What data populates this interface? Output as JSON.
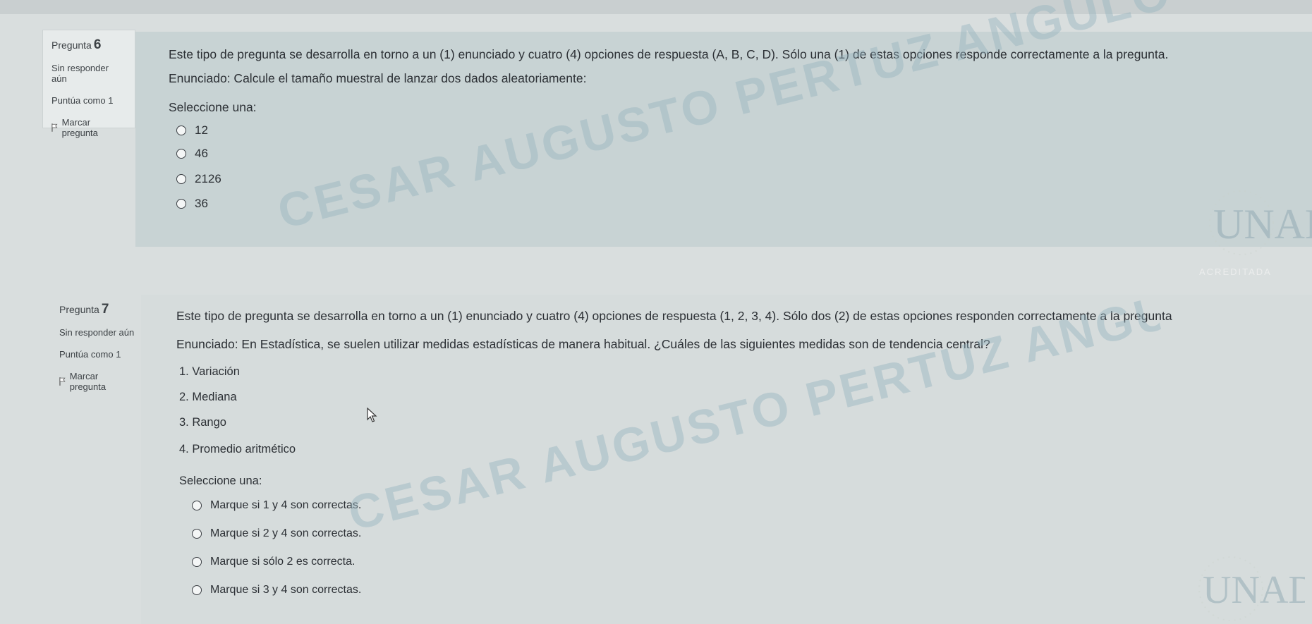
{
  "q6": {
    "label": "Pregunta",
    "number": "6",
    "status": "Sin responder aún",
    "score": "Puntúa como 1",
    "flag": "Marcar pregunta",
    "instructions": "Este tipo de pregunta se desarrolla en torno a un (1) enunciado y cuatro (4) opciones de respuesta (A, B, C, D). Sólo una (1) de estas opciones responde correctamente a la pregunta.",
    "statement": "Enunciado: Calcule el tamaño muestral de lanzar dos dados aleatoriamente:",
    "select_label": "Seleccione una:",
    "options": [
      "12",
      "46",
      "2126",
      "36"
    ]
  },
  "q7": {
    "label": "Pregunta",
    "number": "7",
    "status": "Sin responder aún",
    "score": "Puntúa como 1",
    "flag": "Marcar pregunta",
    "instructions": "Este tipo de pregunta se desarrolla en torno a un (1) enunciado y cuatro (4) opciones de respuesta (1, 2, 3, 4). Sólo dos (2) de estas opciones responden correctamente a la pregunta",
    "statement": "Enunciado: En Estadística, se suelen utilizar medidas estadísticas de manera habitual. ¿Cuáles de las siguientes medidas son de tendencia central?",
    "items": [
      "1. Variación",
      "2. Mediana",
      "3. Rango",
      "4. Promedio aritmético"
    ],
    "select_label": "Seleccione una:",
    "options": [
      "Marque si 1 y 4 son correctas.",
      "Marque si 2 y 4 son correctas.",
      "Marque si sólo 2 es correcta.",
      "Marque si 3 y 4 son correctas."
    ]
  },
  "watermark": {
    "line1": "CESAR AUGUSTO PERTUZ ANGULO",
    "logo_text": "UNAD",
    "logo_caption": "ACREDITADA"
  }
}
